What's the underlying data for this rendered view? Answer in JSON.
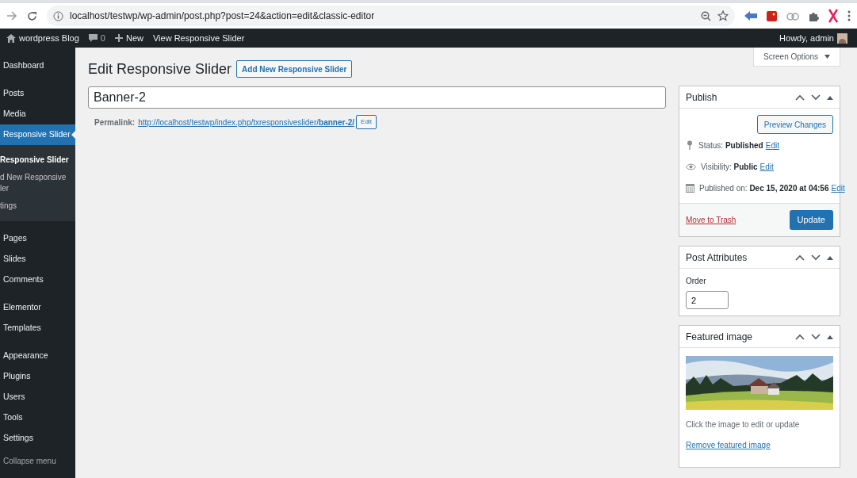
{
  "browser": {
    "url": "localhost/testwp/wp-admin/post.php?post=24&action=edit&classic-editor"
  },
  "admin_bar": {
    "site": "wordpress Blog",
    "comments": "0",
    "new": "New",
    "view": "View Responsive Slider",
    "greeting": "Howdy, admin"
  },
  "sidebar": {
    "groups": [
      [
        {
          "label": "Dashboard",
          "selected": false
        }
      ],
      [
        {
          "label": "Posts",
          "selected": false
        },
        {
          "label": "Media",
          "selected": false
        },
        {
          "label": "Responsive Slider",
          "selected": true,
          "submenu": [
            {
              "label": "Responsive Slider",
              "selected": true
            },
            {
              "label": "d New Responsive ler",
              "selected": false
            },
            {
              "label": "tings",
              "selected": false
            }
          ]
        }
      ],
      [
        {
          "label": "Pages",
          "selected": false
        },
        {
          "label": "Slides",
          "selected": false
        },
        {
          "label": "Comments",
          "selected": false
        }
      ],
      [
        {
          "label": "Elementor",
          "selected": false
        },
        {
          "label": "Templates",
          "selected": false
        }
      ],
      [
        {
          "label": "Appearance",
          "selected": false
        },
        {
          "label": "Plugins",
          "selected": false
        },
        {
          "label": "Users",
          "selected": false
        },
        {
          "label": "Tools",
          "selected": false
        },
        {
          "label": "Settings",
          "selected": false
        }
      ]
    ],
    "collapse": "Collapse menu"
  },
  "screen_options": "Screen Options",
  "heading": "Edit Responsive Slider",
  "add_new": "Add New Responsive Slider",
  "title_value": "Banner-2",
  "permalink": {
    "label": "Permalink:",
    "url": "http://localhost/testwp/index.php/txresponsiveslider/",
    "slug": "banner-2/",
    "edit": "Edit"
  },
  "publish": {
    "title": "Publish",
    "preview": "Preview Changes",
    "rows": [
      {
        "kind": "pin",
        "label": "Status:",
        "value": "Published",
        "edit": "Edit"
      },
      {
        "kind": "eye",
        "label": "Visibility:",
        "value": "Public",
        "edit": "Edit"
      },
      {
        "kind": "calendar",
        "label": "Published on:",
        "value": "Dec 15, 2020 at 04:56",
        "edit": "Edit"
      }
    ],
    "trash": "Move to Trash",
    "update": "Update"
  },
  "attributes": {
    "title": "Post Attributes",
    "order_label": "Order",
    "order_value": "2"
  },
  "featured": {
    "title": "Featured image",
    "hint": "Click the image to edit or update",
    "remove": "Remove featured image"
  }
}
